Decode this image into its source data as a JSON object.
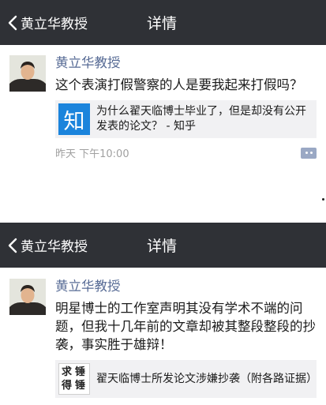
{
  "screens": [
    {
      "nav": {
        "back_label": "黄立华教授",
        "title": "详情"
      },
      "post": {
        "author": "黄立华教授",
        "content": "这个表演打假警察的人是要我起来打假吗？",
        "link": {
          "thumb_icon": "zhihu-logo-icon",
          "thumb_text": "知",
          "text": "为什么翟天临博士毕业了，但是却没有公开发表的论文？ - 知乎"
        },
        "time": "昨天 下午10:00"
      }
    },
    {
      "nav": {
        "back_label": "黄立华教授",
        "title": "详情"
      },
      "post": {
        "author": "黄立华教授",
        "content": "明星博士的工作室声明其没有学术不端的问题，但我十几年前的文章却被其整段整段的抄袭，事实胜于雄辩！",
        "link": {
          "thumb_icon": "qiu-chui-de-chui-logo-icon",
          "thumb_chars": [
            "求",
            "锤",
            "得",
            "锤"
          ],
          "text": "翟天临博士所发论文涉嫌抄袭（附各路证据）"
        }
      }
    }
  ],
  "colors": {
    "navbar_bg": "#2f3136",
    "author_link": "#576b95",
    "zhihu_blue": "#1b84dc",
    "link_card_bg": "#f1f1f3",
    "timestamp": "#a0a0a0"
  }
}
